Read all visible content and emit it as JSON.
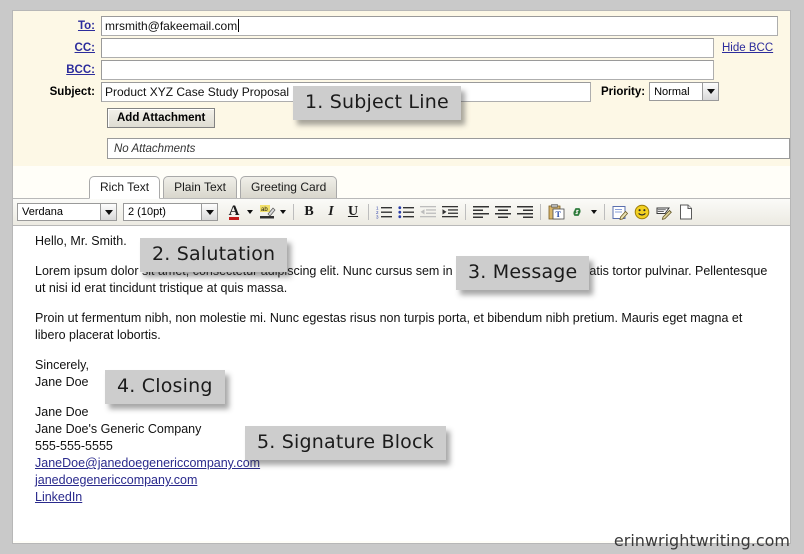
{
  "header": {
    "to": {
      "label": "To:",
      "value": "mrsmith@fakeemail.com"
    },
    "cc": {
      "label": "CC:",
      "value": ""
    },
    "bcc": {
      "label": "BCC:",
      "value": ""
    },
    "hide_bcc_label": "Hide BCC",
    "subject": {
      "label": "Subject:",
      "value": "Product XYZ Case Study Proposal"
    },
    "priority": {
      "label": "Priority:",
      "value": "Normal"
    },
    "add_attachment_label": "Add Attachment",
    "attachments_placeholder": "No Attachments"
  },
  "tabs": [
    {
      "label": "Rich Text",
      "active": true
    },
    {
      "label": "Plain Text",
      "active": false
    },
    {
      "label": "Greeting Card",
      "active": false
    }
  ],
  "toolbar": {
    "font_family": "Verdana",
    "font_size": "2 (10pt)",
    "buttons": [
      "font-color-icon",
      "highlight-icon",
      "bold-icon",
      "italic-icon",
      "underline-icon",
      "numbered-list-icon",
      "bulleted-list-icon",
      "decrease-indent-icon",
      "increase-indent-icon",
      "align-left-icon",
      "align-center-icon",
      "align-right-icon",
      "paste-as-text-icon",
      "insert-link-icon",
      "insert-object-icon",
      "emoticon-icon",
      "signature-icon",
      "new-page-icon"
    ]
  },
  "body": {
    "salutation": "Hello, Mr. Smith.",
    "paragraph1": "Lorem ipsum dolor sit amet, consectetur adipiscing elit. Nunc cursus sem in interdum, lobortis venenatis tortor pulvinar. Pellentesque ut nisi id erat tincidunt tristique at quis massa.",
    "paragraph2": "Proin ut fermentum nibh, non molestie mi. Nunc egestas risus non turpis porta, et bibendum nibh pretium. Mauris eget magna et libero placerat lobortis.",
    "closing_line1": "Sincerely,",
    "closing_line2": "Jane Doe",
    "signature": {
      "name": "Jane Doe",
      "company": "Jane Doe's Generic Company",
      "phone": "555-555-5555",
      "email": "JaneDoe@janedoegenericcompany.com",
      "website": "janedoegenericcompany.com",
      "social": "LinkedIn"
    }
  },
  "callouts": {
    "subject": "1. Subject Line",
    "salutation": "2. Salutation",
    "message": "3. Message",
    "closing": "4. Closing",
    "signature": "5. Signature Block"
  },
  "watermark": "erinwrightwriting.com",
  "colors": {
    "header_background": "#fdf8e6",
    "callout_background": "#cdcdcd",
    "link": "#2c2c9c",
    "page_background": "#c9c9c9"
  }
}
